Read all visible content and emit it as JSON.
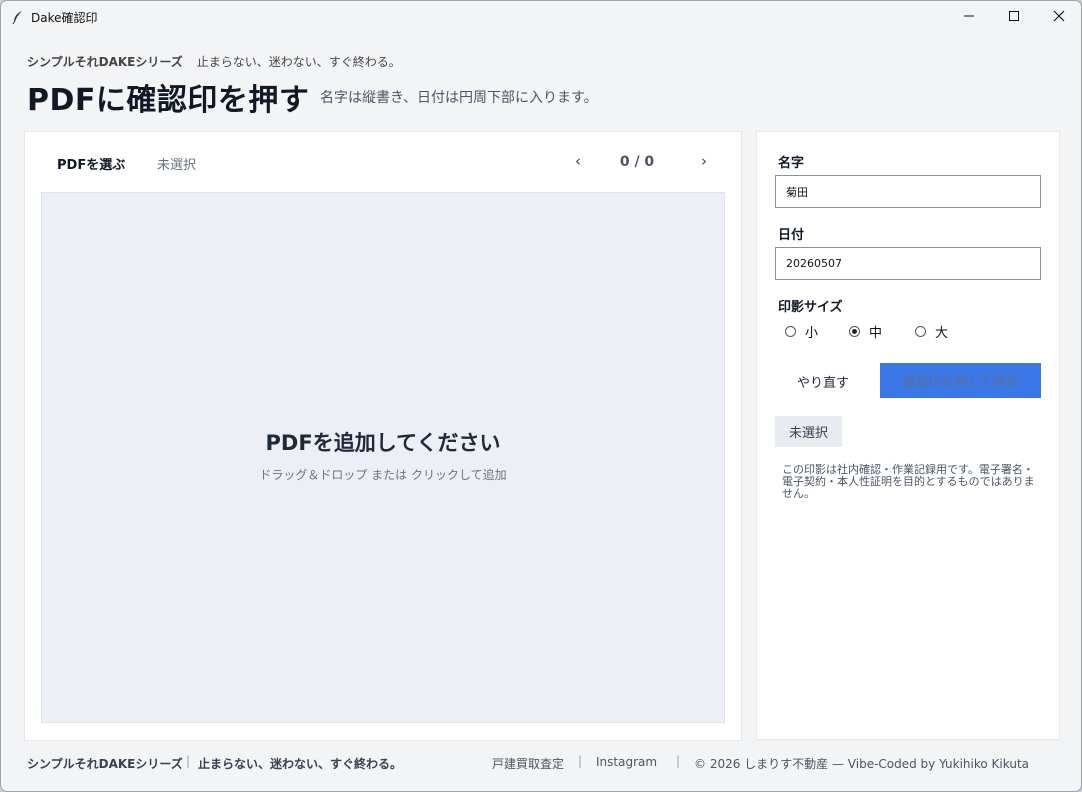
{
  "window": {
    "title": "Dake確認印",
    "icon": "feather-icon",
    "controls": [
      "minimize-icon",
      "maximize-icon",
      "close-icon"
    ]
  },
  "header": {
    "brand": "シンプルそれDAKEシリーズ",
    "tagline": "止まらない、迷わない、すぐ終わる。",
    "title": "PDFに確認印を押す",
    "description": "名字は縦書き、日付は円周下部に入ります。"
  },
  "viewer": {
    "pick_label": "PDFを選ぶ",
    "file_status": "未選択",
    "prev": "‹",
    "page_indicator": "0 / 0",
    "next": "›",
    "drop_title": "PDFを追加してください",
    "drop_hint": "ドラッグ＆ドロップ または クリックして追加"
  },
  "form": {
    "name_label": "名字",
    "name_value": "菊田",
    "date_label": "日付",
    "date_value": "20260507",
    "size_label": "印影サイズ",
    "size_options": [
      {
        "label": "小",
        "checked": false
      },
      {
        "label": "中",
        "checked": true
      },
      {
        "label": "大",
        "checked": false
      }
    ],
    "redo_label": "やり直す",
    "save_label": "確認印を押して保存",
    "status": "未選択",
    "disclaimer": "この印影は社内確認・作業記録用です。電子署名・電子契約・本人性証明を目的とするものではありません。"
  },
  "footer": {
    "brand": "シンプルそれDAKEシリーズ",
    "sep": "|",
    "tagline": "止まらない、迷わない、すぐ終わる。",
    "link1": "戸建買取査定",
    "link2": "Instagram",
    "copyright": "© 2026 しまりす不動産 — Vibe-Coded by Yukihiko Kikuta"
  },
  "colors": {
    "accent": "#3b78e7",
    "panel": "#ffffff",
    "dropzone": "#eceff5",
    "background": "#f3f4f6"
  }
}
